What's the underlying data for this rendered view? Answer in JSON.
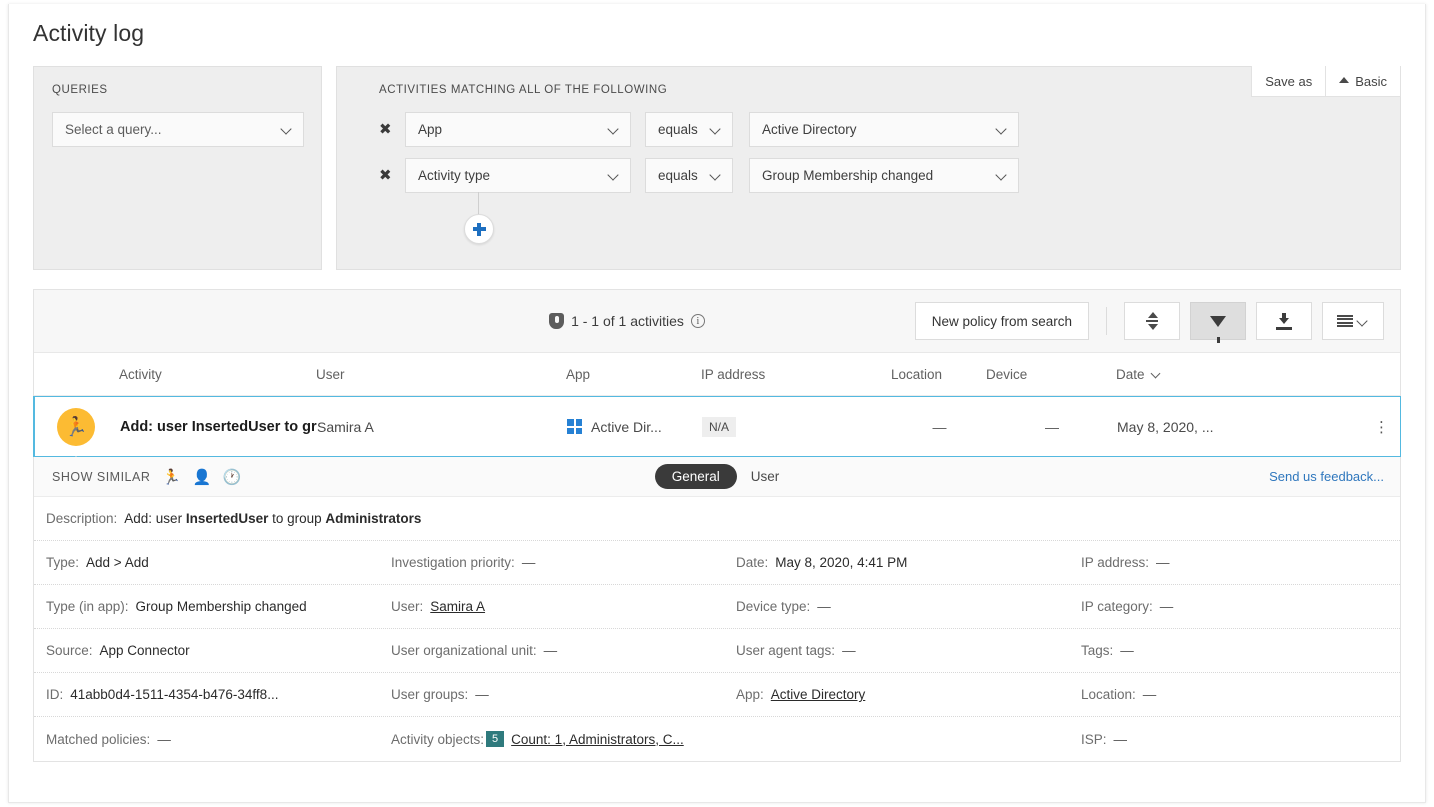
{
  "page": {
    "title": "Activity log"
  },
  "queries": {
    "label": "QUERIES",
    "select_value": "Select a query..."
  },
  "conditions": {
    "label": "ACTIVITIES MATCHING ALL OF THE FOLLOWING",
    "save_as": "Save as",
    "basic": "Basic",
    "rows": [
      {
        "field": "App",
        "operator": "equals",
        "value": "Active Directory"
      },
      {
        "field": "Activity type",
        "operator": "equals",
        "value": "Group Membership changed"
      }
    ]
  },
  "toolbar": {
    "count": "1 - 1 of 1 activities",
    "new_policy": "New policy from search"
  },
  "table": {
    "headers": {
      "activity": "Activity",
      "user": "User",
      "app": "App",
      "ip": "IP address",
      "location": "Location",
      "device": "Device",
      "date": "Date"
    },
    "row": {
      "activity": "Add: user InsertedUser to group ...",
      "user": "Samira A",
      "app": "Active Dir...",
      "ip": "N/A",
      "location": "—",
      "device": "—",
      "date": "May 8, 2020, ..."
    }
  },
  "detail": {
    "show_similar": "SHOW SIMILAR",
    "tab_general": "General",
    "tab_user": "User",
    "feedback": "Send us feedback...",
    "description": {
      "label": "Description:",
      "prefix": "Add: user ",
      "bold1": "InsertedUser",
      "middle": " to group ",
      "bold2": "Administrators"
    },
    "fields": {
      "type_label": "Type:",
      "type_value": "Add > Add",
      "inv_label": "Investigation priority:",
      "inv_value": "—",
      "date_label": "Date:",
      "date_value": "May 8, 2020, 4:41 PM",
      "ipaddr_label": "IP address:",
      "ipaddr_value": "—",
      "typeapp_label": "Type (in app):",
      "typeapp_value": "Group Membership changed",
      "user_label": "User:",
      "user_value": "Samira A",
      "devtype_label": "Device type:",
      "devtype_value": "—",
      "ipcat_label": "IP category:",
      "ipcat_value": "—",
      "source_label": "Source:",
      "source_value": "App Connector",
      "uou_label": "User organizational unit:",
      "uou_value": "—",
      "uat_label": "User agent tags:",
      "uat_value": "—",
      "tags_label": "Tags:",
      "tags_value": "—",
      "id_label": "ID:",
      "id_value": "41abb0d4-1511-4354-b476-34ff8...",
      "ugroups_label": "User groups:",
      "ugroups_value": "—",
      "app_label": "App:",
      "app_value": "Active Directory",
      "loc_label": "Location:",
      "loc_value": "—",
      "mp_label": "Matched policies:",
      "mp_value": "—",
      "ao_label": "Activity objects:",
      "ao_badge": "5",
      "ao_value": "Count: 1, Administrators, C...",
      "isp_label": "ISP:",
      "isp_value": "—"
    }
  },
  "icons": {
    "runner": "🏃",
    "person": "👤",
    "clock": "🕐",
    "kebab": "⋮",
    "close": "✖"
  },
  "colors": {
    "accent_blue": "#2f77bd",
    "selection_border": "#54b9e0",
    "badge_orange": "#fcbb33",
    "badge_teal": "#2f7a7d",
    "win_blue": "#2681d4"
  }
}
